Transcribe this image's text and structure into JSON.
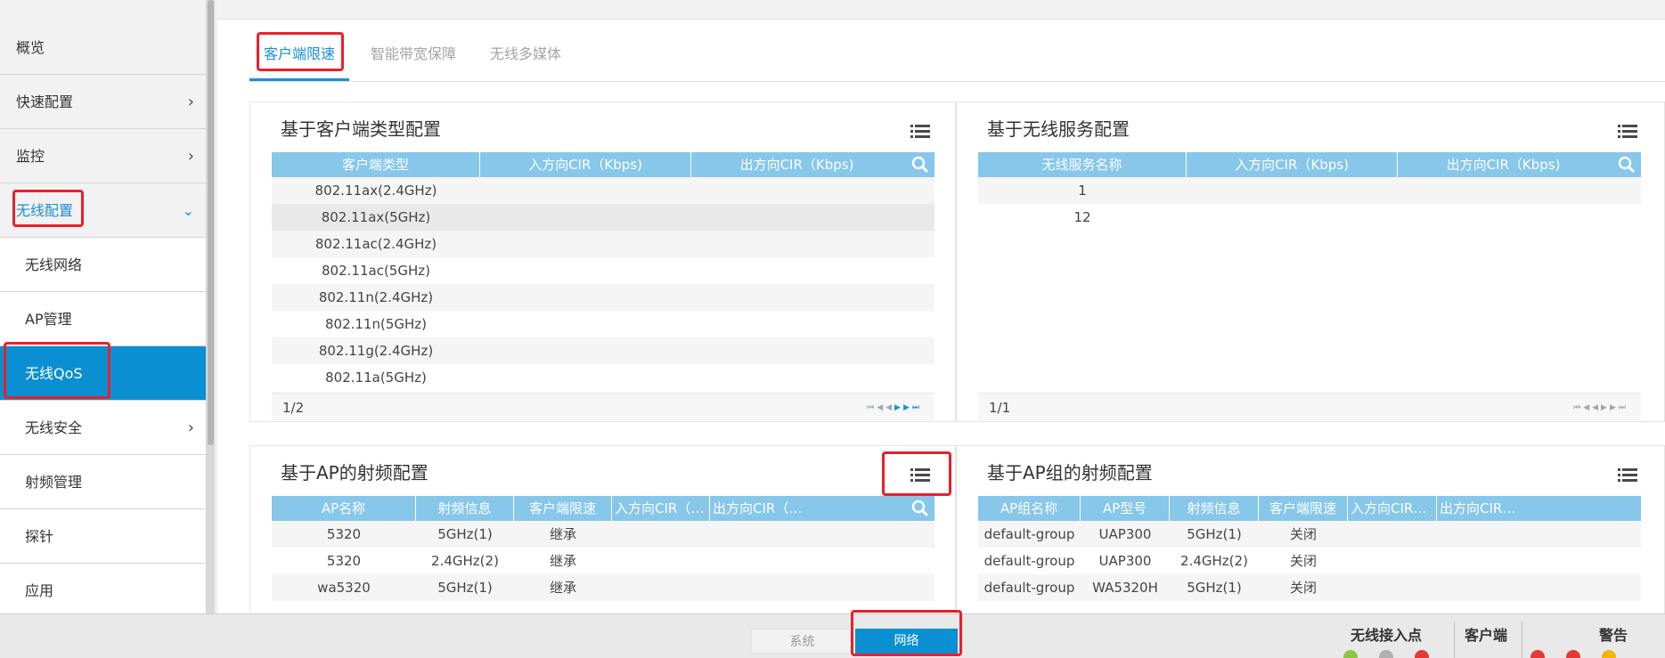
{
  "sidebar": {
    "items": [
      {
        "label": "概览",
        "type": "top"
      },
      {
        "label": "快速配置",
        "type": "top",
        "chevron": "›"
      },
      {
        "label": "监控",
        "type": "top",
        "chevron": "›"
      },
      {
        "label": "无线配置",
        "type": "open",
        "chevron": "⌄"
      },
      {
        "label": "无线网络",
        "type": "sub"
      },
      {
        "label": "AP管理",
        "type": "sub"
      },
      {
        "label": "无线QoS",
        "type": "active"
      },
      {
        "label": "无线安全",
        "type": "sub",
        "chevron": "›"
      },
      {
        "label": "射频管理",
        "type": "sub"
      },
      {
        "label": "探针",
        "type": "sub"
      },
      {
        "label": "应用",
        "type": "sub"
      }
    ]
  },
  "tabs": [
    {
      "label": "客户端限速",
      "active": true
    },
    {
      "label": "智能带宽保障",
      "active": false
    },
    {
      "label": "无线多媒体",
      "active": false
    }
  ],
  "panels": {
    "client_type": {
      "title": "基于客户端类型配置",
      "columns": [
        "客户端类型",
        "入方向CIR（Kbps)",
        "出方向CIR（Kbps)"
      ],
      "rows": [
        [
          "802.11ax(2.4GHz)",
          "",
          ""
        ],
        [
          "802.11ax(5GHz)",
          "",
          ""
        ],
        [
          "802.11ac(2.4GHz)",
          "",
          ""
        ],
        [
          "802.11ac(5GHz)",
          "",
          ""
        ],
        [
          "802.11n(2.4GHz)",
          "",
          ""
        ],
        [
          "802.11n(5GHz)",
          "",
          ""
        ],
        [
          "802.11g(2.4GHz)",
          "",
          ""
        ],
        [
          "802.11a(5GHz)",
          "",
          ""
        ]
      ],
      "pager": "1/2"
    },
    "wireless_service": {
      "title": "基于无线服务配置",
      "columns": [
        "无线服务名称",
        "入方向CIR（Kbps)",
        "出方向CIR（Kbps)"
      ],
      "rows": [
        [
          "1",
          "",
          ""
        ],
        [
          "12",
          "",
          ""
        ]
      ],
      "pager": "1/1"
    },
    "ap_radio": {
      "title": "基于AP的射频配置",
      "columns": [
        "AP名称",
        "射频信息",
        "客户端限速",
        "入方向CIR（Kbp...",
        "出方向CIR（Kbp..."
      ],
      "rows": [
        [
          "5320",
          "5GHz(1)",
          "继承",
          "",
          ""
        ],
        [
          "5320",
          "2.4GHz(2)",
          "继承",
          "",
          ""
        ],
        [
          "wa5320",
          "5GHz(1)",
          "继承",
          "",
          ""
        ]
      ]
    },
    "ap_group_radio": {
      "title": "基于AP组的射频配置",
      "columns": [
        "AP组名称",
        "AP型号",
        "射频信息",
        "客户端限速",
        "入方向CIR（K...",
        "出方向CIR（K..."
      ],
      "rows": [
        [
          "default-group",
          "UAP300",
          "5GHz(1)",
          "关闭",
          "",
          ""
        ],
        [
          "default-group",
          "UAP300",
          "2.4GHz(2)",
          "关闭",
          "",
          ""
        ],
        [
          "default-group",
          "WA5320H",
          "5GHz(1)",
          "关闭",
          "",
          ""
        ]
      ]
    }
  },
  "bottom": {
    "tabs": [
      {
        "label": "系统",
        "active": false
      },
      {
        "label": "网络",
        "active": true
      }
    ],
    "stats": {
      "aps": "无线接入点",
      "clients": "客户端",
      "alarms": "警告"
    }
  },
  "colors": {
    "accent": "#0a8fd2",
    "header": "#86c7ea",
    "highlight": "#e8202a"
  }
}
